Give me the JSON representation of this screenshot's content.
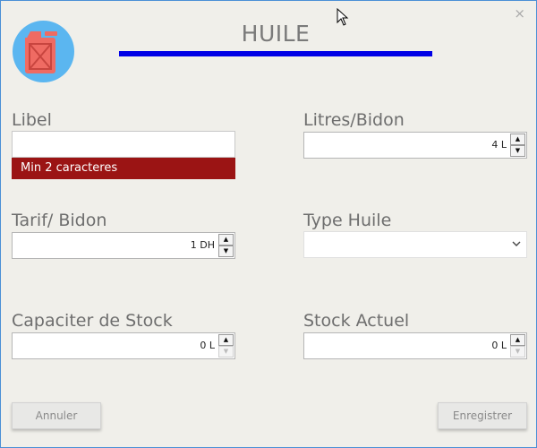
{
  "window": {
    "title": "HUILE",
    "close_glyph": "×"
  },
  "logo": {
    "icon": "jerrycan-icon",
    "bg": "#5bb6f0",
    "fg": "#ef6b63"
  },
  "form": {
    "libel": {
      "label": "Libel",
      "value": "",
      "error": "Min 2 caracteres"
    },
    "litres_bidon": {
      "label": "Litres/Bidon",
      "value": "4 L"
    },
    "tarif_bidon": {
      "label": "Tarif/ Bidon",
      "value": "1 DH"
    },
    "type_huile": {
      "label": "Type Huile",
      "value": ""
    },
    "capaciter_stock": {
      "label": "Capaciter de Stock",
      "value": "0 L"
    },
    "stock_actuel": {
      "label": "Stock Actuel",
      "value": "0 L"
    }
  },
  "buttons": {
    "cancel": "Annuler",
    "save": "Enregistrer"
  },
  "colors": {
    "accent_bar": "#0000e6",
    "error_bg": "#9b1414",
    "window_bg": "#f0efea"
  }
}
